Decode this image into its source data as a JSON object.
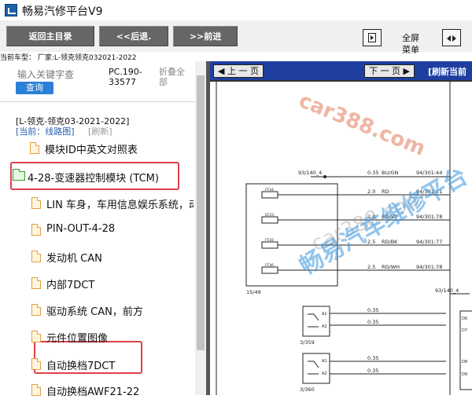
{
  "app": {
    "title": "畅易汽修平台V9"
  },
  "toolbar": {
    "home_label": "返回主目录",
    "back_label": "<<后退.",
    "forward_label": ">>前进",
    "fullscreen_label": "全屏",
    "menu_label": "菜单"
  },
  "vehicle_line": "当前车型： 厂家:L-领克领克032021-2022",
  "search": {
    "placeholder": "输入关键字查",
    "button_label": "查询",
    "doc_code": "PC.190-33577",
    "collapse_all": "折叠全部"
  },
  "tree": {
    "model_path": "[L-领克-领克03-2021-2022]",
    "current_label": "[当前：线路图]",
    "refresh_label": "[刷新]",
    "items": [
      {
        "label": "模块ID中英文对照表",
        "type": "doc"
      },
      {
        "label": "4-28-变速器控制模块 (TCM)",
        "type": "folder"
      },
      {
        "label": "LIN 车身，车用信息娱乐系统，动",
        "type": "doc"
      },
      {
        "label": "PIN-OUT-4-28",
        "type": "doc"
      },
      {
        "label": "发动机 CAN",
        "type": "doc"
      },
      {
        "label": "内部7DCT",
        "type": "doc"
      },
      {
        "label": "驱动系统 CAN，前方",
        "type": "doc"
      },
      {
        "label": "元件位置图像",
        "type": "doc"
      },
      {
        "label": "自动换档7DCT",
        "type": "doc"
      },
      {
        "label": "自动换档AWF21-22",
        "type": "doc"
      }
    ]
  },
  "viewer": {
    "prev_label": "上 一 页",
    "next_label": "下 一 页",
    "refresh_label": "[刷新当前",
    "watermarks": [
      "car388.com",
      "car388.com",
      "畅易汽车维修平台"
    ],
    "diagram": {
      "connectors": [
        "93/140_4",
        "15/49",
        "93/140_4",
        "3/359",
        "3/360"
      ],
      "fuse_labels": [
        "FF34",
        "EF23",
        "FF16",
        "FF36"
      ],
      "wires": [
        {
          "size": "0.35",
          "color": "BU/GN",
          "pin": "94/301:44"
        },
        {
          "size": "2.0",
          "color": "RD",
          "pin": "94/301:11"
        },
        {
          "size": "2.0",
          "color": "RD/VT",
          "pin": "94/301:78"
        },
        {
          "size": "2.5",
          "color": "RD/BK",
          "pin": "94/301:77"
        },
        {
          "size": "2.5",
          "color": "RD/WH",
          "pin": "94/301:78"
        }
      ],
      "lower_wires": [
        "0.35",
        "0.35",
        "0.35",
        "0.35"
      ],
      "pins": [
        "A1",
        "A2",
        "A1",
        "A2",
        "D6",
        "D7",
        "D8",
        "D9"
      ]
    }
  }
}
